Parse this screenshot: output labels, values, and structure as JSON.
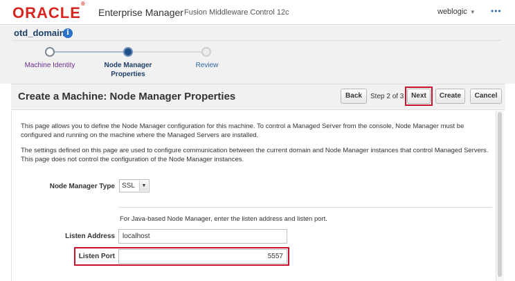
{
  "header": {
    "logo": "ORACLE",
    "product": "Enterprise Manager",
    "product_sub": "Fusion Middleware Control 12c",
    "user": "weblogic",
    "more": "•••"
  },
  "domain": {
    "title": "otd_domain",
    "info_glyph": "i"
  },
  "train": {
    "steps": [
      {
        "label": "Machine Identity",
        "state": "visited"
      },
      {
        "label": "Node Manager Properties",
        "state": "current"
      },
      {
        "label": "Review",
        "state": "future"
      }
    ]
  },
  "page": {
    "title": "Create a Machine: Node Manager Properties",
    "step_text": "Step 2 of 3",
    "buttons": {
      "back": "Back",
      "next": "Next",
      "create": "Create",
      "cancel": "Cancel"
    }
  },
  "content": {
    "para1": "This page allows you to define the Node Manager configuration for this machine. To control a Managed Server from the console, Node Manager must be configured and running on the machine where the Managed Servers are installed.",
    "para2": "The settings defined on this page are used to configure communication between the current domain and Node Manager instances that control Managed Servers. This page does not control the configuration of the Node Manager instances.",
    "node_manager_type_label": "Node Manager Type",
    "node_manager_type_value": "SSL",
    "hint": "For Java-based Node Manager, enter the listen address and listen port.",
    "listen_address_label": "Listen Address",
    "listen_address_value": "localhost",
    "listen_port_label": "Listen Port",
    "listen_port_value": "5557"
  },
  "colors": {
    "brand": "#d7261f",
    "highlight": "#c8102e",
    "current_step": "#1f4d86"
  }
}
